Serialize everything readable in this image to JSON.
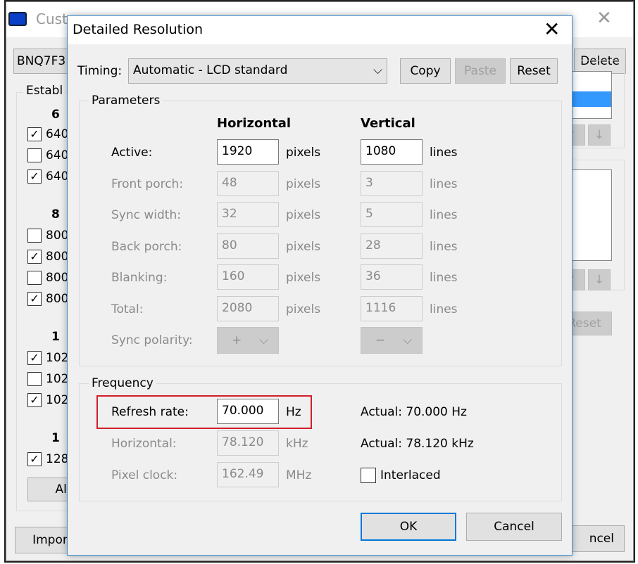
{
  "background_window": {
    "title": "Cust",
    "monitor_field": "BNQ7F3",
    "delete_label": "Delete",
    "established_label": "Establ",
    "group_headers": [
      "6",
      "8",
      "1",
      "1"
    ],
    "checkboxes": [
      {
        "text": "640",
        "checked": true
      },
      {
        "text": "640",
        "checked": false
      },
      {
        "text": "640",
        "checked": true
      },
      {
        "text": "800",
        "checked": false
      },
      {
        "text": "800",
        "checked": true
      },
      {
        "text": "800",
        "checked": false
      },
      {
        "text": "800",
        "checked": true
      },
      {
        "text": "102",
        "checked": true
      },
      {
        "text": "102",
        "checked": false
      },
      {
        "text": "102",
        "checked": true
      },
      {
        "text": "128",
        "checked": true
      }
    ],
    "all_label": "All",
    "import_label": "Impor",
    "reset_label": "Reset",
    "cancel_label": "ncel"
  },
  "dialog": {
    "title": "Detailed Resolution",
    "timing_label": "Timing:",
    "timing_value": "Automatic - LCD standard",
    "copy_label": "Copy",
    "paste_label": "Paste",
    "reset_label": "Reset",
    "parameters": {
      "title": "Parameters",
      "horizontal_header": "Horizontal",
      "vertical_header": "Vertical",
      "rows": [
        {
          "label": "Active:",
          "h": "1920",
          "h_unit": "pixels",
          "v": "1080",
          "v_unit": "lines"
        },
        {
          "label": "Front porch:",
          "h": "48",
          "h_unit": "pixels",
          "v": "3",
          "v_unit": "lines"
        },
        {
          "label": "Sync width:",
          "h": "32",
          "h_unit": "pixels",
          "v": "5",
          "v_unit": "lines"
        },
        {
          "label": "Back porch:",
          "h": "80",
          "h_unit": "pixels",
          "v": "28",
          "v_unit": "lines"
        },
        {
          "label": "Blanking:",
          "h": "160",
          "h_unit": "pixels",
          "v": "36",
          "v_unit": "lines"
        },
        {
          "label": "Total:",
          "h": "2080",
          "h_unit": "pixels",
          "v": "1116",
          "v_unit": "lines"
        }
      ],
      "sync_polarity_label": "Sync polarity:",
      "sync_h": "+",
      "sync_v": "−"
    },
    "frequency": {
      "title": "Frequency",
      "refresh_label": "Refresh rate:",
      "refresh_value": "70.000",
      "refresh_unit": "Hz",
      "refresh_actual": "Actual: 70.000 Hz",
      "horizontal_label": "Horizontal:",
      "horizontal_value": "78.120",
      "horizontal_unit": "kHz",
      "horizontal_actual": "Actual: 78.120 kHz",
      "pixel_clock_label": "Pixel clock:",
      "pixel_clock_value": "162.49",
      "pixel_clock_unit": "MHz",
      "interlaced_label": "Interlaced",
      "interlaced": false
    },
    "ok_label": "OK",
    "cancel_label": "Cancel"
  },
  "colors": {
    "highlight": "#d0202a",
    "accent": "#3c8fd0",
    "selection": "#3399ff"
  }
}
